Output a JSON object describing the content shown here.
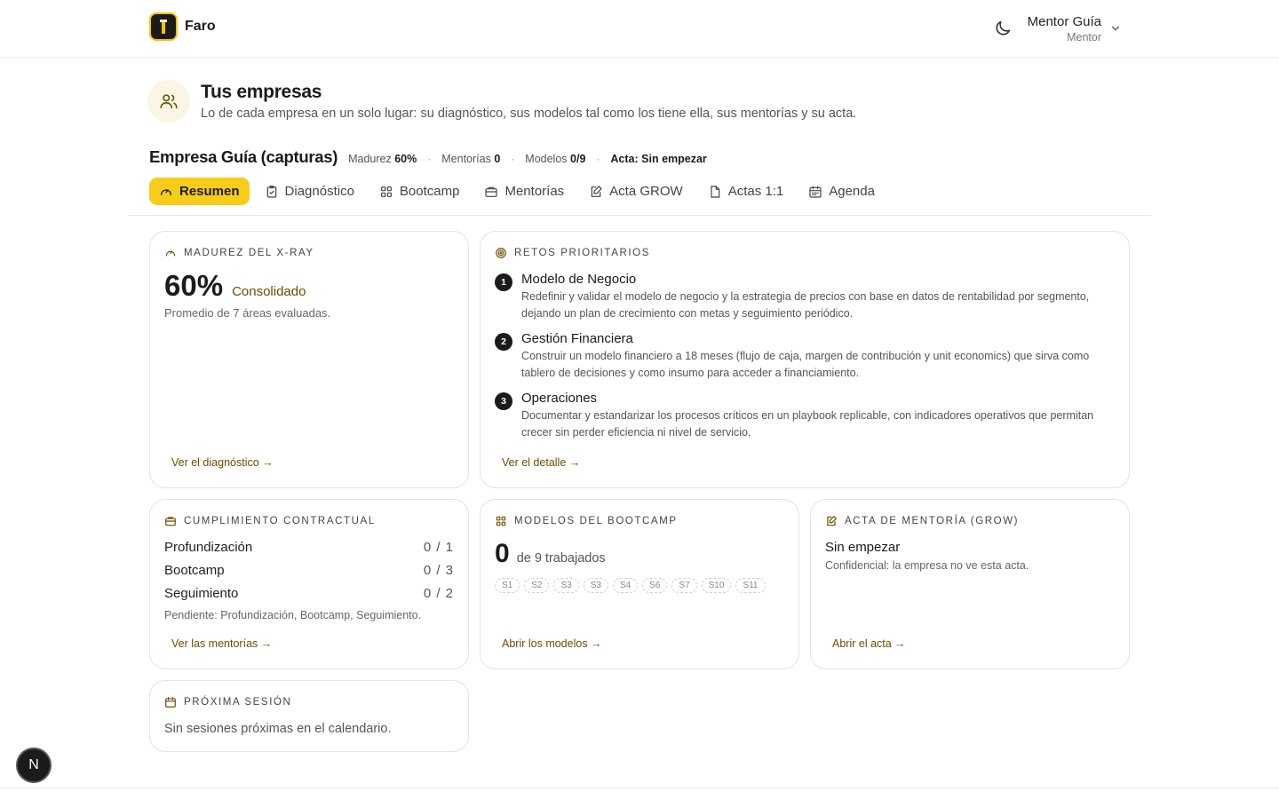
{
  "app": {
    "name": "Faro"
  },
  "user": {
    "name": "Mentor Guía",
    "role": "Mentor"
  },
  "page": {
    "title": "Tus empresas",
    "subtitle": "Lo de cada empresa en un solo lugar: su diagnóstico, sus modelos tal como los tiene ella, sus mentorías y su acta."
  },
  "company": {
    "name": "Empresa Guía (capturas)",
    "meta": {
      "madurez_label": "Madurez",
      "madurez_value": "60%",
      "mentorias_label": "Mentorías",
      "mentorias_value": "0",
      "modelos_label": "Modelos",
      "modelos_value": "0/9",
      "acta_label": "Acta:",
      "acta_value": "Sin empezar",
      "separator": "·"
    }
  },
  "tabs": [
    {
      "label": "Resumen",
      "icon": "gauge-icon",
      "active": true
    },
    {
      "label": "Diagnóstico",
      "icon": "clipboard-check-icon",
      "active": false
    },
    {
      "label": "Bootcamp",
      "icon": "grid-icon",
      "active": false
    },
    {
      "label": "Mentorías",
      "icon": "briefcase-icon",
      "active": false
    },
    {
      "label": "Acta GROW",
      "icon": "edit-icon",
      "active": false
    },
    {
      "label": "Actas 1:1",
      "icon": "file-icon",
      "active": false
    },
    {
      "label": "Agenda",
      "icon": "calendar-icon",
      "active": false
    }
  ],
  "madurez": {
    "label": "MADUREZ DEL X-RAY",
    "value": "60%",
    "status": "Consolidado",
    "note": "Promedio de 7 áreas evaluadas.",
    "link": "Ver el diagnóstico →"
  },
  "retos": {
    "label": "RETOS PRIORITARIOS",
    "items": [
      {
        "num": "1",
        "title": "Modelo de Negocio",
        "desc": "Redefinir y validar el modelo de negocio y la estrategia de precios con base en datos de rentabilidad por segmento, dejando un plan de crecimiento con metas y seguimiento periódico."
      },
      {
        "num": "2",
        "title": "Gestión Financiera",
        "desc": "Construir un modelo financiero a 18 meses (flujo de caja, margen de contribución y unit economics) que sirva como tablero de decisiones y como insumo para acceder a financiamiento."
      },
      {
        "num": "3",
        "title": "Operaciones",
        "desc": "Documentar y estandarizar los procesos críticos en un playbook replicable, con indicadores operativos que permitan crecer sin perder eficiencia ni nivel de servicio."
      }
    ],
    "link": "Ver el detalle →"
  },
  "cumplimiento": {
    "label": "CUMPLIMIENTO CONTRACTUAL",
    "rows": [
      {
        "name": "Profundización",
        "value": "0 / 1"
      },
      {
        "name": "Bootcamp",
        "value": "0 / 3"
      },
      {
        "name": "Seguimiento",
        "value": "0 / 2"
      }
    ],
    "pending": "Pendiente: Profundización, Bootcamp, Seguimiento.",
    "link": "Ver las mentorías →"
  },
  "modelos": {
    "label": "MODELOS DEL BOOTCAMP",
    "count": "0",
    "of_text": "de 9 trabajados",
    "chips": [
      "S1",
      "S2",
      "S3",
      "S3",
      "S4",
      "S6",
      "S7",
      "S10",
      "S11"
    ],
    "link": "Abrir los modelos →"
  },
  "acta": {
    "label": "ACTA DE MENTORÍA (GROW)",
    "status": "Sin empezar",
    "note": "Confidencial: la empresa no ve esta acta.",
    "link": "Abrir el acta →"
  },
  "proxima": {
    "label": "PRÓXIMA SESIÓN",
    "note": "Sin sesiones próximas en el calendario."
  },
  "fab": {
    "label": "N"
  },
  "colors": {
    "accent": "#f7cd1a",
    "link": "#6b4e00",
    "dark": "#1b1b1b"
  }
}
